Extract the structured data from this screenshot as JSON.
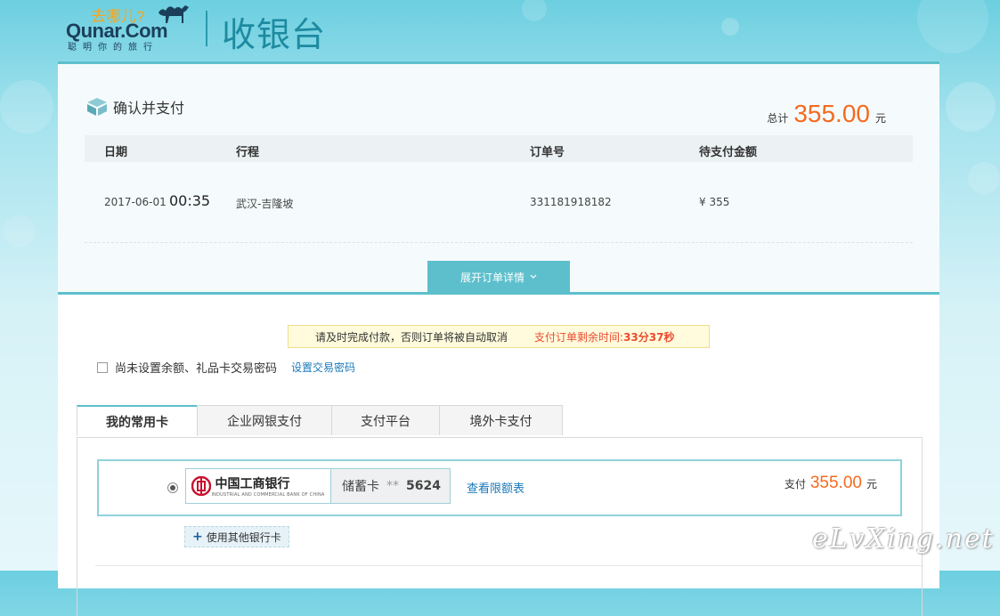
{
  "header": {
    "logo_top": "去哪儿?",
    "logo_brand": "Qunar.Com",
    "logo_slogan": "聪明你的旅行",
    "title": "收银台"
  },
  "order": {
    "section_title": "确认并支付",
    "total_label": "总计",
    "total_amount": "355.00",
    "total_unit": "元",
    "columns": [
      "日期",
      "行程",
      "订单号",
      "待支付金额"
    ],
    "row": {
      "date": "2017-06-01",
      "time": "00:35",
      "route": "武汉-吉隆坡",
      "order_no": "331181918182",
      "amount": "¥ 355"
    },
    "expand_label": "展开订单详情"
  },
  "notice": {
    "text": "请及时完成付款，否则订单将被自动取消",
    "countdown_label": "支付订单剩余时间:",
    "countdown_value": "33分37秒"
  },
  "password": {
    "label": "尚未设置余额、礼品卡交易密码",
    "link": "设置交易密码"
  },
  "tabs": [
    "我的常用卡",
    "企业网银支付",
    "支付平台",
    "境外卡支付"
  ],
  "card": {
    "bank_name": "中国工商银行",
    "bank_name_en": "INDUSTRIAL AND COMMERCIAL BANK OF CHINA",
    "card_type": "储蓄卡",
    "card_mask": "**",
    "card_last4": "5624",
    "limit_link": "查看限额表",
    "pay_label": "支付",
    "pay_amount": "355.00",
    "pay_unit": "元"
  },
  "other_card_label": "使用其他银行卡",
  "watermark": "eLvXing.net",
  "colors": {
    "accent": "#5dbfcc",
    "price": "#f56a1f",
    "link": "#1a79b9",
    "warning": "#ec4b30"
  }
}
